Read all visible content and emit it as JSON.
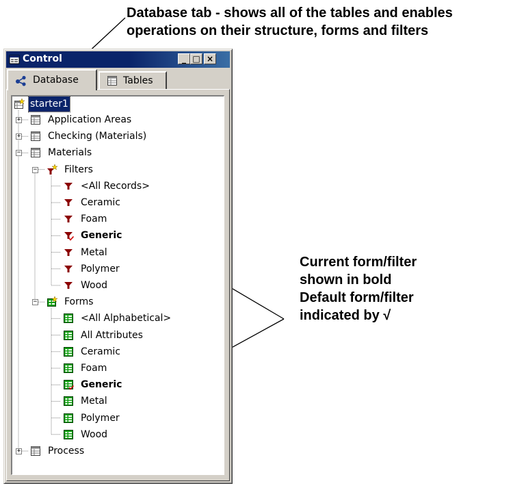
{
  "annotations": {
    "top_line1": "Database tab - shows all of the tables and enables",
    "top_line2": "operations on their structure, forms and filters",
    "right_line1": "Current form/filter",
    "right_line2_prefix": "shown in ",
    "right_line2_bold": "bold",
    "right_line3": "Default form/filter",
    "right_line4": "indicated by √"
  },
  "window": {
    "title": "Control",
    "minimize_glyph": "_",
    "maximize_glyph": "□",
    "close_glyph": "×"
  },
  "tabs": [
    {
      "label": "Database",
      "icon": "database-icon",
      "active": true
    },
    {
      "label": "Tables",
      "icon": "table-icon",
      "active": false
    }
  ],
  "tree": {
    "root": {
      "label": "starter1",
      "selected": true,
      "icon": "database-new-icon"
    },
    "tables": [
      {
        "label": "Application Areas",
        "expanded": false,
        "icon": "table-icon"
      },
      {
        "label": "Checking (Materials)",
        "expanded": false,
        "icon": "table-icon"
      },
      {
        "label": "Materials",
        "expanded": true,
        "icon": "table-icon"
      },
      {
        "label": "Process",
        "expanded": false,
        "icon": "table-icon"
      }
    ],
    "filters_group": {
      "label": "Filters",
      "icon": "filters-group-icon"
    },
    "filters": [
      {
        "label": "<All Records>",
        "current": false,
        "default": false
      },
      {
        "label": "Ceramic",
        "current": false,
        "default": false
      },
      {
        "label": "Foam",
        "current": false,
        "default": false
      },
      {
        "label": "Generic",
        "current": true,
        "default": true
      },
      {
        "label": "Metal",
        "current": false,
        "default": false
      },
      {
        "label": "Polymer",
        "current": false,
        "default": false
      },
      {
        "label": "Wood",
        "current": false,
        "default": false
      }
    ],
    "forms_group": {
      "label": "Forms",
      "icon": "forms-group-icon"
    },
    "forms": [
      {
        "label": "<All Alphabetical>",
        "current": false,
        "default": false
      },
      {
        "label": "All Attributes",
        "current": false,
        "default": false
      },
      {
        "label": "Ceramic",
        "current": false,
        "default": false
      },
      {
        "label": "Foam",
        "current": false,
        "default": false
      },
      {
        "label": "Generic",
        "current": true,
        "default": true
      },
      {
        "label": "Metal",
        "current": false,
        "default": false
      },
      {
        "label": "Polymer",
        "current": false,
        "default": false
      },
      {
        "label": "Wood",
        "current": false,
        "default": false
      }
    ]
  },
  "colors": {
    "titlebar": "#0a246a",
    "filter_icon": "#8b0000",
    "form_icon": "#10a010",
    "default_check": "#d00000"
  }
}
